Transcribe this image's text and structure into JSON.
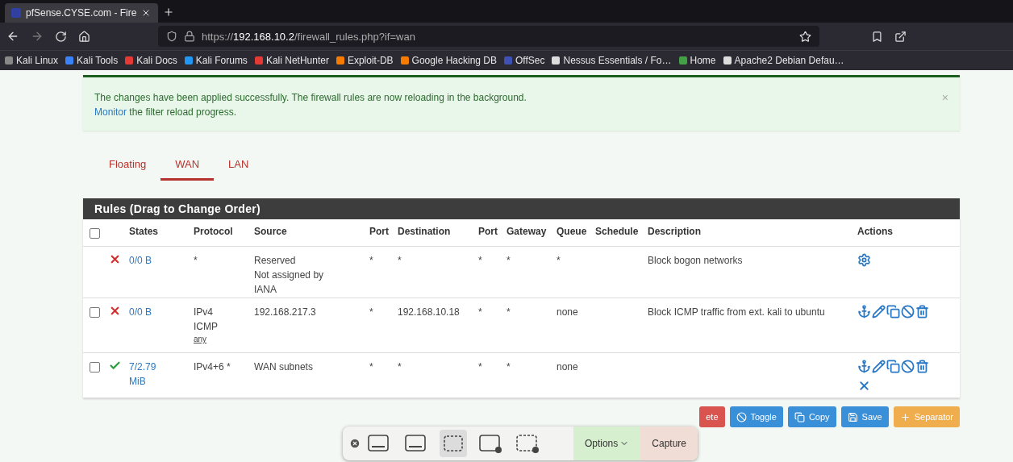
{
  "browser": {
    "tabs": [
      {
        "title": "pfSense.CYSE.com - Fire",
        "selected": true
      }
    ],
    "url": "https://**192.168.10.2**/firewall_rules.php?if=wan",
    "bookmarks": [
      {
        "label": "Kali Linux",
        "color": "#888888"
      },
      {
        "label": "Kali Tools",
        "color": "#3b82f6"
      },
      {
        "label": "Kali Docs",
        "color": "#e53935"
      },
      {
        "label": "Kali Forums",
        "color": "#2196f3"
      },
      {
        "label": "Kali NetHunter",
        "color": "#e53935"
      },
      {
        "label": "Exploit-DB",
        "color": "#f57c00"
      },
      {
        "label": "Google Hacking DB",
        "color": "#f57c00"
      },
      {
        "label": "OffSec",
        "color": "#3f51b5"
      },
      {
        "label": "Nessus Essentials / Fo…",
        "color": "#dddddd"
      },
      {
        "label": "Home",
        "color": "#43a047"
      },
      {
        "label": "Apache2 Debian Defau…",
        "color": "#dddddd"
      }
    ]
  },
  "alert": {
    "text": "The changes have been applied successfully. The firewall rules are now reloading in the background.",
    "link": "Monitor",
    "rest": "the filter reload progress.",
    "close": "×"
  },
  "interface_tabs": [
    {
      "label": "Floating",
      "selected": false
    },
    {
      "label": "WAN",
      "selected": true
    },
    {
      "label": "LAN",
      "selected": false
    }
  ],
  "panel_title": "Rules (Drag to Change Order)",
  "select_all": {
    "checked": false
  },
  "columns": [
    "States",
    "Protocol",
    "Source",
    "Port",
    "Destination",
    "Port",
    "Gateway",
    "Queue",
    "Schedule",
    "Description",
    "Actions"
  ],
  "rows": [
    {
      "kind": "block",
      "states": "0/0 B",
      "protocol": [
        "*"
      ],
      "source": [
        "Reserved",
        "Not assigned by",
        "IANA"
      ],
      "port": "*",
      "destination": "*",
      "port_2": "*",
      "gateway": "*",
      "queue": "*",
      "description": "Block bogon networks",
      "actions": [
        {
          "kind": "gear"
        }
      ]
    },
    {
      "checked": false,
      "kind": "block",
      "states": "0/0 B",
      "protocol": [
        "IPv4",
        "ICMP"
      ],
      "protocol_sub": "any",
      "source": [
        "192.168.217.3"
      ],
      "port": "*",
      "destination": "192.168.10.18",
      "port_2": "*",
      "gateway": "*",
      "queue": "none",
      "description": "Block ICMP traffic from ext. kali to ubuntu",
      "actions": [
        {
          "kind": "anchor"
        },
        {
          "kind": "edit"
        },
        {
          "kind": "copy"
        },
        {
          "kind": "disable"
        },
        {
          "kind": "delete"
        }
      ]
    },
    {
      "checked": false,
      "kind": "pass",
      "states": "7/2.79 MiB",
      "protocol": [
        "IPv4+6 *"
      ],
      "source": [
        "WAN subnets"
      ],
      "port": "*",
      "destination": "*",
      "port_2": "*",
      "gateway": "*",
      "queue": "none",
      "actions": [
        {
          "kind": "anchor"
        },
        {
          "kind": "edit"
        },
        {
          "kind": "copy"
        },
        {
          "kind": "disable"
        },
        {
          "kind": "delete"
        },
        {
          "kind": "remove"
        }
      ]
    }
  ],
  "buttons": [
    {
      "label": "ete",
      "kind": "delete"
    },
    {
      "label": "Toggle",
      "kind": "toggle"
    },
    {
      "label": "Copy",
      "kind": "copy"
    },
    {
      "label": "Save",
      "kind": "save"
    },
    {
      "label": "Separator",
      "kind": "separator"
    }
  ],
  "capture_toolbar": {
    "options": "Options",
    "capture": "Capture"
  }
}
